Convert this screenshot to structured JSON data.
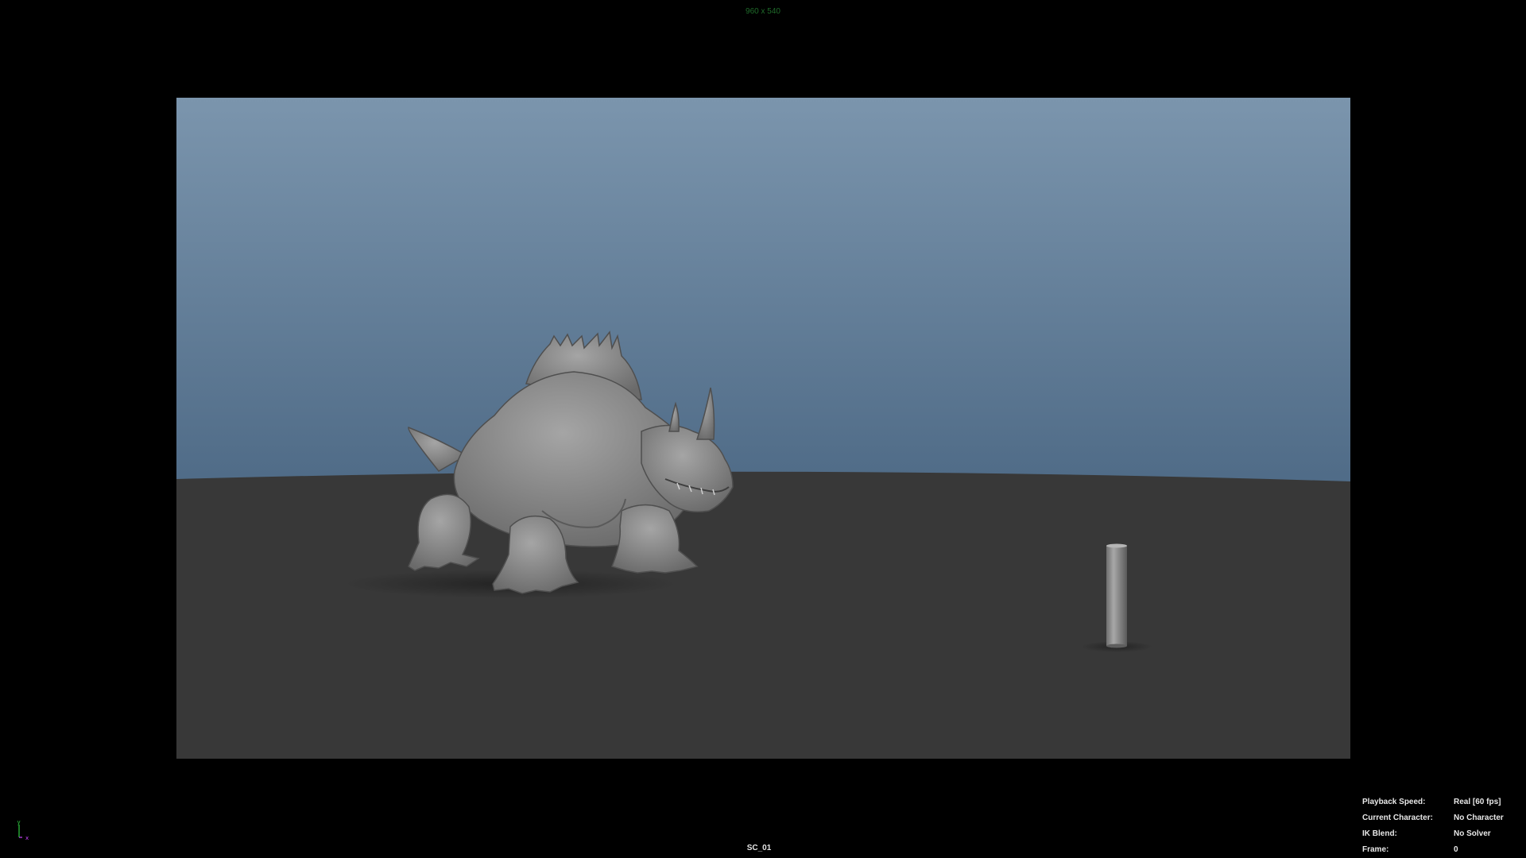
{
  "viewport": {
    "resolution": "960 x 540",
    "camera_name": "SC_01"
  },
  "axis_gizmo": {
    "y_label": "y",
    "x_label": "x",
    "y_color": "#2ecc40",
    "x_color": "#cc44ff"
  },
  "scene": {
    "sky_top_color": "#7b95ad",
    "sky_bottom_color": "#4e6a86",
    "ground_color": "#383838",
    "model_color": "#8a8a8a",
    "objects": [
      "creature-model",
      "cylinder-prop",
      "ground-plane"
    ]
  },
  "hud": {
    "rows": [
      {
        "label": "Playback Speed:",
        "value": "Real [60 fps]"
      },
      {
        "label": "Current Character:",
        "value": "No Character"
      },
      {
        "label": "IK Blend:",
        "value": "No Solver"
      },
      {
        "label": "Frame:",
        "value": "0"
      }
    ]
  }
}
